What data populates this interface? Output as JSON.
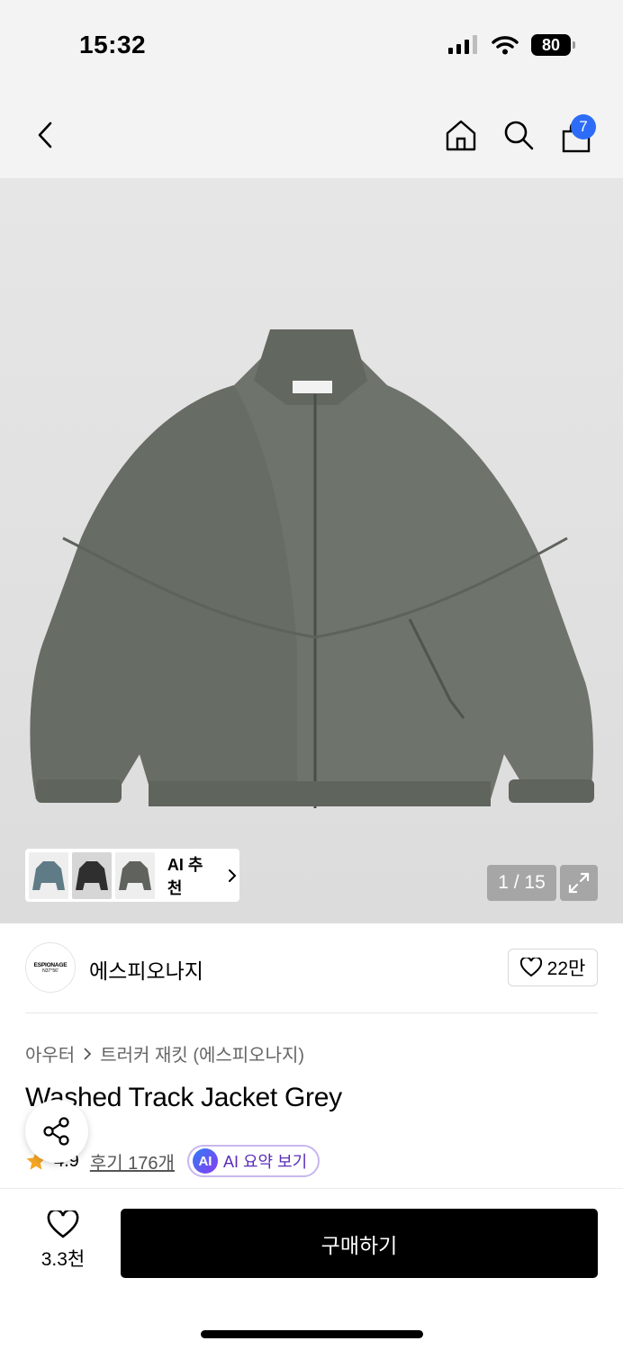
{
  "status_bar": {
    "time": "15:32",
    "battery": "80"
  },
  "nav": {
    "cart_count": "7"
  },
  "gallery": {
    "ai_recommend_label": "AI 추천",
    "image_counter": "1 / 15"
  },
  "brand": {
    "logo_line1": "ESPIONAGE",
    "logo_line2": "N37°56'",
    "name": "에스피오나지",
    "like_count": "22만"
  },
  "product": {
    "breadcrumb": [
      "아우터",
      "트러커 재킷 (에스피오나지)"
    ],
    "title": "Washed Track Jacket Grey",
    "rating": "4.9",
    "review_link": "후기 176개",
    "ai_badge": "AI",
    "ai_summary_label": "AI 요약 보기"
  },
  "bottom_bar": {
    "wish_count": "3.3천",
    "buy_label": "구매하기"
  },
  "colors": {
    "accent_blue": "#2d6cf6",
    "ai_purple": "#5a2db8",
    "star": "#f5a623"
  }
}
